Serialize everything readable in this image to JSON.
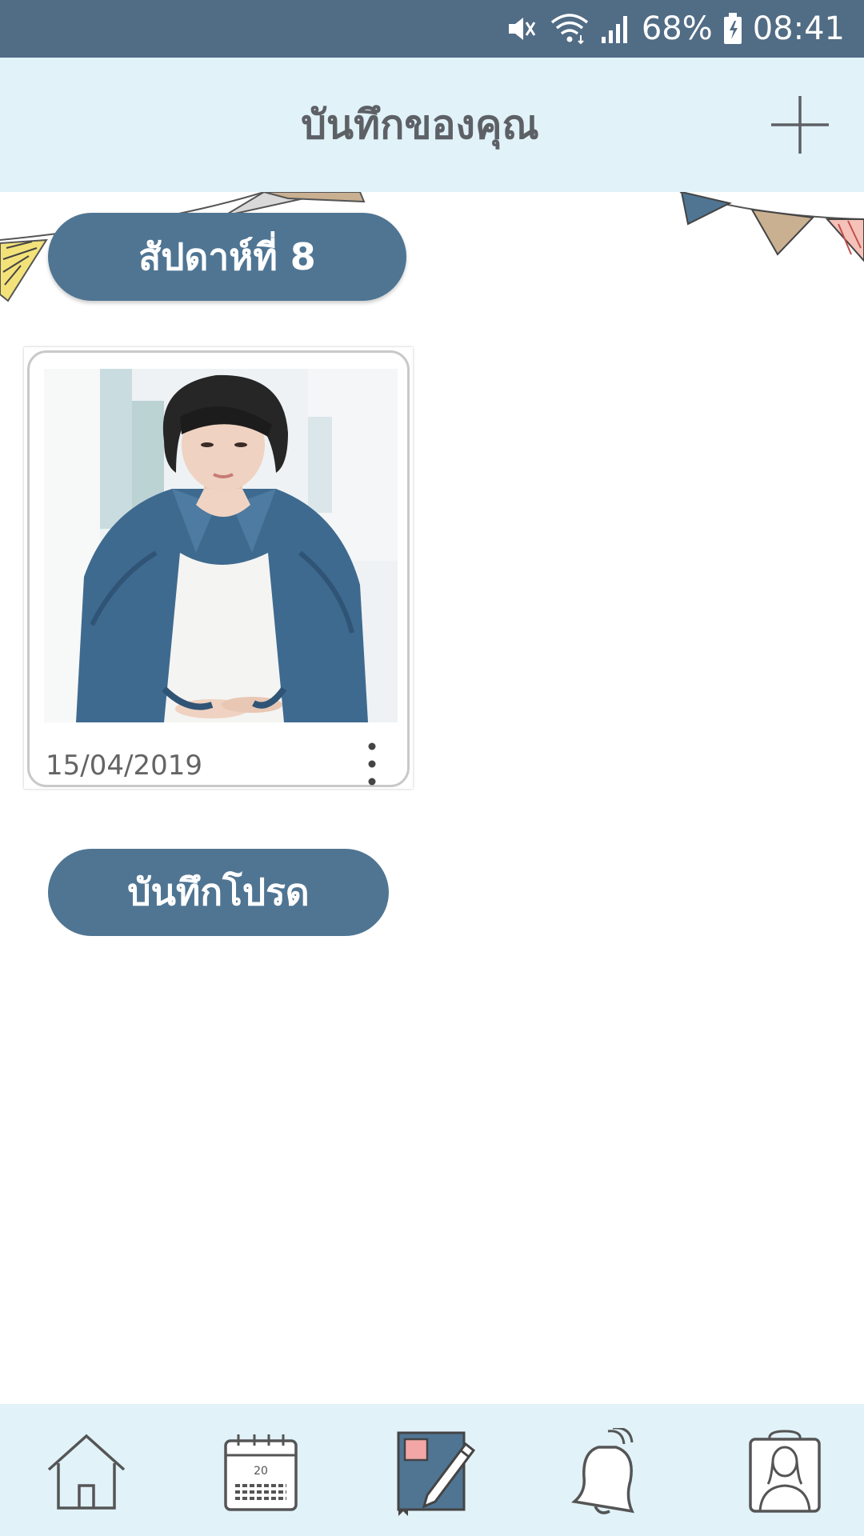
{
  "status_bar": {
    "battery": "68%",
    "time": "08:41",
    "icons": [
      "mute-icon",
      "wifi-icon",
      "signal-icon",
      "battery-icon"
    ]
  },
  "header": {
    "title": "บันทึกของคุณ",
    "add_icon": "plus-icon"
  },
  "main": {
    "week_label": "สัปดาห์ที่ 8",
    "card": {
      "date": "15/04/2019",
      "menu_icon": "more-vertical-icon"
    },
    "favorite_label": "บันทึกโปรด"
  },
  "bottom_nav": {
    "items": [
      {
        "icon": "home-icon"
      },
      {
        "icon": "calendar-icon",
        "day": "20"
      },
      {
        "icon": "notebook-edit-icon"
      },
      {
        "icon": "bell-icon"
      },
      {
        "icon": "profile-icon"
      }
    ]
  },
  "colors": {
    "status_bar": "#516c85",
    "header_bg": "#e1f2f9",
    "accent": "#4f7593",
    "title_text": "#5d6166"
  }
}
